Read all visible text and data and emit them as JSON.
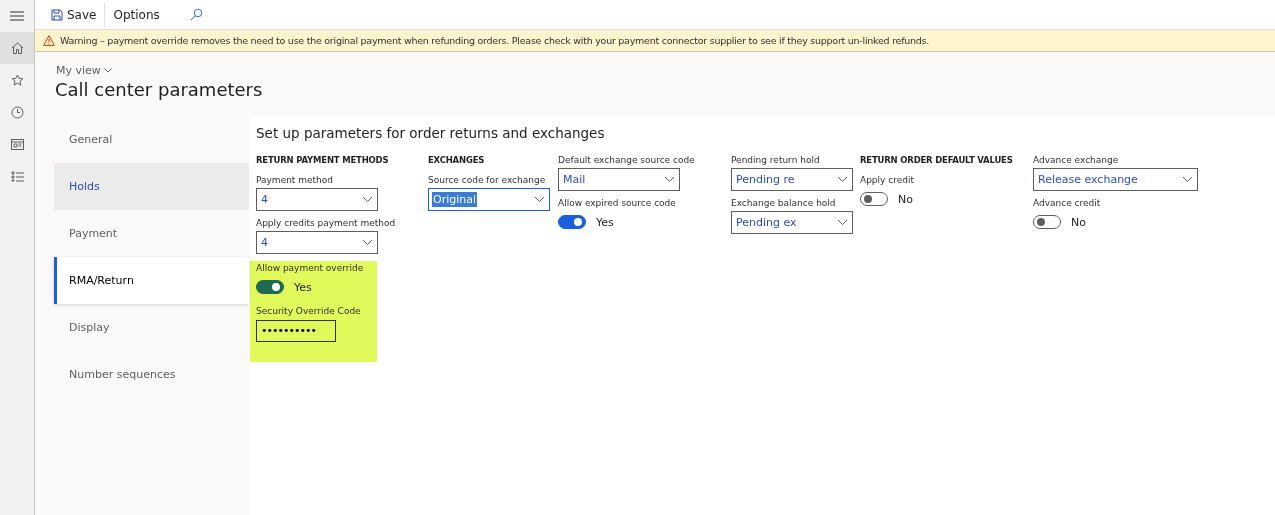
{
  "toolbar": {
    "buttons": [
      {
        "kind": "save",
        "label": "Save"
      },
      {
        "kind": "text",
        "label": "Options"
      },
      {
        "kind": "search"
      }
    ]
  },
  "warning": "Warning – payment override removes the need to use the original payment when refunding orders. Please check with your payment connector supplier to see if they support un-linked refunds.",
  "header": {
    "view": "My view",
    "title": "Call center parameters"
  },
  "tabs": [
    {
      "label": "General",
      "selected": false,
      "hovered": false
    },
    {
      "label": "Holds",
      "selected": false,
      "hovered": true
    },
    {
      "label": "Payment",
      "selected": false,
      "hovered": false
    },
    {
      "label": "RMA/Return",
      "selected": true,
      "hovered": false
    },
    {
      "label": "Display",
      "selected": false,
      "hovered": false
    },
    {
      "label": "Number sequences",
      "selected": false,
      "hovered": false
    }
  ],
  "panel": {
    "title": "Set up parameters for order returns and exchanges",
    "columns": [
      {
        "items": [
          {
            "kind": "heading",
            "label": "RETURN PAYMENT METHODS"
          },
          {
            "kind": "dropdown",
            "label": "Payment method",
            "value": "4",
            "text_selected": false
          },
          {
            "kind": "dropdown",
            "label": "Apply credits payment method",
            "value": "4",
            "text_selected": false
          },
          {
            "kind": "group",
            "highlighted": true,
            "items": [
              {
                "kind": "toggle",
                "label": "Allow payment override",
                "on": true,
                "state": "Yes"
              },
              {
                "kind": "password",
                "label": "Security Override Code",
                "value": "••••••••••"
              }
            ]
          }
        ]
      },
      {
        "items": [
          {
            "kind": "heading",
            "label": "EXCHANGES"
          },
          {
            "kind": "dropdown",
            "label": "Source code for exchange",
            "value": "Original",
            "text_selected": true
          }
        ]
      },
      {
        "items": [
          {
            "kind": "dropdown",
            "label": "Default exchange source code",
            "value": "Mail",
            "text_selected": false
          },
          {
            "kind": "toggle",
            "label": "Allow expired source code",
            "on": true,
            "state": "Yes"
          }
        ]
      },
      {
        "items": [
          {
            "kind": "dropdown",
            "label": "Pending return hold",
            "value": "Pending re",
            "text_selected": false
          },
          {
            "kind": "dropdown",
            "label": "Exchange balance hold",
            "value": "Pending ex",
            "text_selected": false
          }
        ]
      },
      {
        "items": [
          {
            "kind": "heading",
            "label": "RETURN ORDER DEFAULT VALUES"
          },
          {
            "kind": "toggle",
            "label": "Apply credit",
            "on": false,
            "state": "No"
          }
        ]
      },
      {
        "items": [
          {
            "kind": "dropdown",
            "label": "Advance exchange",
            "value": "Release exchange",
            "text_selected": false
          },
          {
            "kind": "toggle",
            "label": "Advance credit",
            "on": false,
            "state": "No"
          }
        ]
      }
    ]
  }
}
